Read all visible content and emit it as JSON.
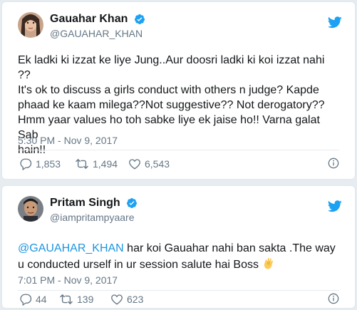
{
  "tweets": [
    {
      "display_name": "Gauahar Khan",
      "handle": "@GAUAHAR_KHAN",
      "verified_icon": "verified-badge-icon",
      "text": "Ek ladki ki izzat ke liye Jung..Aur doosri ladki ki koi izzat nahi ??\nIt's ok to discuss a girls conduct with others n judge? Kapde\nphaad ke kaam milega??Not suggestive?? Not derogatory??\nHmm yaar values ho toh sabke liye ek jaise ho!! Varna galat Sab\nhain!!",
      "timestamp": "5:30 PM - Nov 9, 2017",
      "replies": "1,853",
      "retweets": "1,494",
      "likes": "6,543"
    },
    {
      "display_name": "Pritam Singh",
      "handle": "@iampritampyaare",
      "verified_icon": "verified-badge-icon",
      "mention": "@GAUAHAR_KHAN",
      "text": " har koi Gauahar nahi ban sakta .The way\nu conducted urself in ur session salute hai Boss",
      "emoji": "clapping-hands-emoji",
      "timestamp": "7:01 PM - Nov 9, 2017",
      "replies": "44",
      "retweets": "139",
      "likes": "623"
    }
  ],
  "colors": {
    "twitter_blue": "#1da1f2",
    "link_blue": "#1b95e0",
    "gray_text": "#657786",
    "background": "#e6ecf0"
  }
}
